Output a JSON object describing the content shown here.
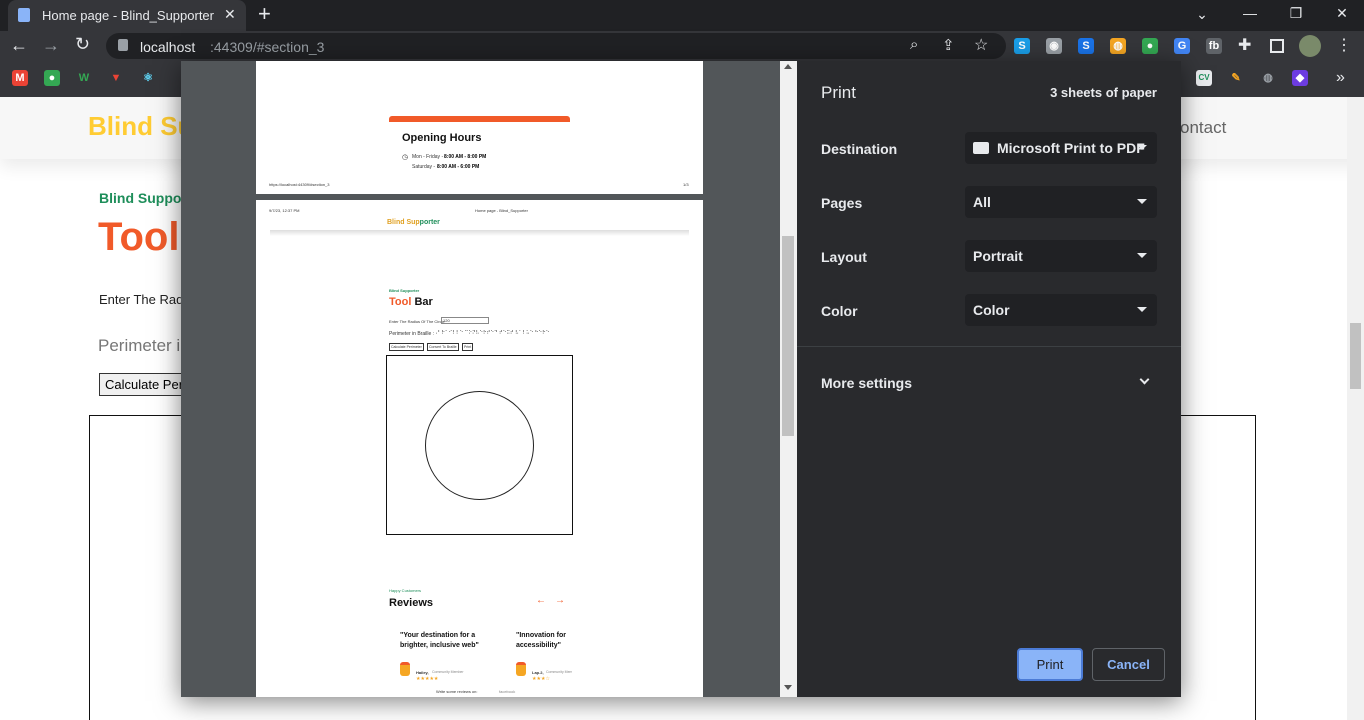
{
  "browser": {
    "tab_title": "Home page - Blind_Supporter",
    "new_tab": "+",
    "url_host": "localhost",
    "url_rest": ":44309/#section_3",
    "window_controls": [
      "⌄",
      "—",
      "❐",
      "✕"
    ]
  },
  "bookmarks": {
    "more": "»"
  },
  "site": {
    "brand_part1": "Blind Su",
    "nav_contact": "ontact",
    "section_kicker": "Blind Support",
    "section_title": "Tool",
    "radius_label": "Enter The Radi",
    "perimeter_label": "Perimeter in",
    "calc_button": "Calculate Peri"
  },
  "preview": {
    "page1": {
      "opening_hours": "Opening Hours",
      "row1_day": "Mon - Friday -",
      "row1_time": "8:00 AM - 8:00 PM",
      "row2_day": "Saturday -",
      "row2_time": "8:00 AM - 6:00 PM",
      "footer_url": "https://localhost:44309/#section_3",
      "footer_page": "1/3"
    },
    "page2": {
      "header_date": "9/7/23, 12:37 PM",
      "header_title": "Home page - Blind_Supporter",
      "brand_a": "Blind Sup",
      "brand_b": "porter",
      "kicker": "Blind Supporter",
      "title_a": "Tool",
      "title_b": "Bar",
      "radius_label": "Enter The Radius Of The Circle",
      "radius_value": "120",
      "perimeter_label": "Perimeter in Braille :",
      "perimeter_braille": "⠠⠃⠗⠁⠊⠇⠇⠑ ⠉⠕⠝⠧⠑⠗⠞⠑⠙ ⠞⠑⠭⠞ ⠧⠁⠇⠥⠑ ⠓⠑⠗⠑",
      "btn_calc": "Calculate Perimeter",
      "btn_braille": "Convert To Braille",
      "btn_print": "Print",
      "reviews_kicker": "Happy Customers",
      "reviews_title": "Reviews",
      "arrow_prev": "←",
      "arrow_next": "→",
      "review1_quote": "\"Your destination for a brighter, inclusive web\"",
      "review1_name": "Hailey,",
      "review1_role": "Community Member",
      "review1_stars": "★★★★★",
      "review2_quote": "\"Innovation for accessibility\"",
      "review2_name": "Lap.2,",
      "review2_role": "Community Member",
      "review2_stars": "★★★☆",
      "write_review": "Write some reviews on:",
      "write_review_link": "facebook"
    }
  },
  "print_settings": {
    "title": "Print",
    "sheets": "3 sheets of paper",
    "destination_label": "Destination",
    "destination_value": "Microsoft Print to PDF",
    "pages_label": "Pages",
    "pages_value": "All",
    "layout_label": "Layout",
    "layout_value": "Portrait",
    "color_label": "Color",
    "color_value": "Color",
    "more_settings": "More settings",
    "print_button": "Print",
    "cancel_button": "Cancel"
  },
  "colors": {
    "accent_orange": "#f15a29",
    "accent_yellow": "#ffcc33",
    "accent_green": "#1e8e5a",
    "print_blue": "#8ab4f8"
  }
}
